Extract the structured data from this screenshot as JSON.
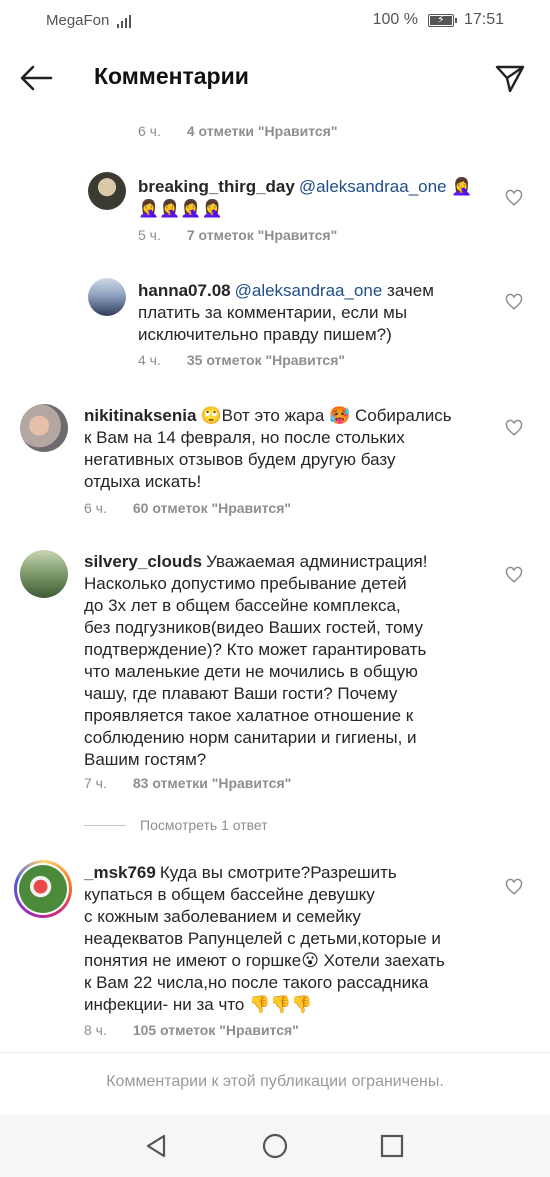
{
  "status_bar": {
    "carrier": "MegaFon",
    "battery": "100 %",
    "time": "17:51"
  },
  "header": {
    "title": "Комментарии"
  },
  "top_meta": {
    "time": "6 ч.",
    "likes": "4 отметки \"Нравится\""
  },
  "comments": [
    {
      "username": "breaking_thirg_day",
      "mention": "@aleksandraa_one",
      "text_line1": "🤦‍♀️",
      "text_line2": "🤦‍♀️🤦‍♀️🤦‍♀️🤦‍♀️",
      "time": "5 ч.",
      "likes": "7 отметок \"Нравится\""
    },
    {
      "username": "hanna07.08",
      "mention": "@aleksandraa_one",
      "text_line1": "зачем",
      "text_line2": "платить за комментарии, если мы",
      "text_line3": "исключительно правду пишем?)",
      "time": "4 ч.",
      "likes": "35 отметок \"Нравится\""
    },
    {
      "username": "nikitinaksenia",
      "text_line1": "🙄Вот это жара 🥵 Собирались",
      "text_line2": "к Вам на 14 февраля, но после стольких",
      "text_line3": "негативных отзывов  будем другую базу",
      "text_line4": "отдыха искать!",
      "time": "6 ч.",
      "likes": "60 отметок \"Нравится\""
    },
    {
      "username": "silvery_clouds",
      "text_line1": "Уважаемая администрация!",
      "text_line2": "Насколько допустимо пребывание детей",
      "text_line3": "до 3х лет в общем бассейне комплекса,",
      "text_line4": "без подгузников(видео Ваших гостей, тому",
      "text_line5": "подтверждение)? Кто может гарантировать",
      "text_line6": "что маленькие дети не мочились в общую",
      "text_line7": "чашу, где плавают Ваши гости? Почему",
      "text_line8": "проявляется такое халатное отношение к",
      "text_line9": "соблюдению норм санитарии и гигиены, и",
      "text_line10": "Вашим гостям?",
      "time": "7 ч.",
      "likes": "83 отметки \"Нравится\"",
      "view_replies": "Посмотреть 1 ответ"
    },
    {
      "username": "_msk769",
      "text_line1": "Куда вы смотрите?Разрешить",
      "text_line2": "купаться в общем бассейне девушку",
      "text_line3": "с кожным заболеванием и семейку",
      "text_line4": "неадекватов Рапунцелей с детьми,которые и",
      "text_line5": "понятия не имеют о горшке😮 Хотели заехать",
      "text_line6": "к Вам 22 числа,но после такого рассадника",
      "text_line7": "инфекции- ни за что 👎👎👎",
      "time": "8 ч.",
      "likes": "105 отметок \"Нравится\""
    }
  ],
  "footer": {
    "note": "Комментарии к этой публикации ограничены."
  },
  "colors": {
    "mention": "#1f4f8a",
    "meta": "#8e8e8e",
    "text": "#262626"
  }
}
